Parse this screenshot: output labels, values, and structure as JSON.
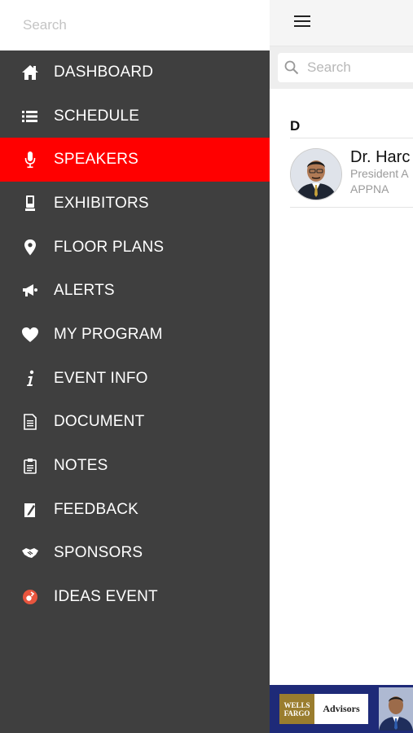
{
  "sidebar": {
    "search_placeholder": "Search",
    "active_color": "#ff0000",
    "items": [
      {
        "label": "DASHBOARD",
        "icon": "home-icon",
        "active": false
      },
      {
        "label": "SCHEDULE",
        "icon": "list-icon",
        "active": false
      },
      {
        "label": "SPEAKERS",
        "icon": "microphone-icon",
        "active": true
      },
      {
        "label": "EXHIBITORS",
        "icon": "booth-icon",
        "active": false
      },
      {
        "label": "FLOOR PLANS",
        "icon": "map-pin-icon",
        "active": false
      },
      {
        "label": "ALERTS",
        "icon": "megaphone-icon",
        "active": false
      },
      {
        "label": "MY PROGRAM",
        "icon": "heart-icon",
        "active": false
      },
      {
        "label": "EVENT INFO",
        "icon": "info-icon",
        "active": false
      },
      {
        "label": "DOCUMENT",
        "icon": "document-icon",
        "active": false
      },
      {
        "label": "NOTES",
        "icon": "clipboard-icon",
        "active": false
      },
      {
        "label": "FEEDBACK",
        "icon": "feedback-icon",
        "active": false
      },
      {
        "label": "SPONSORS",
        "icon": "handshake-icon",
        "active": false
      },
      {
        "label": "IDEAS EVENT",
        "icon": "ideas-event-icon",
        "active": false
      }
    ]
  },
  "main": {
    "search_placeholder": "Search",
    "section_letter": "D",
    "speaker": {
      "name": "Dr. Harc",
      "title": "President A",
      "org": "APPNA"
    },
    "banner": {
      "brand_line1": "WELLS",
      "brand_line2": "FARGO",
      "advisors": "Advisors"
    }
  }
}
